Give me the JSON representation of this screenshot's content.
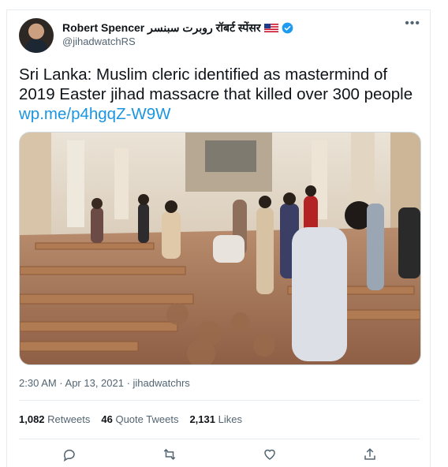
{
  "author": {
    "display_name": "Robert Spencer روبرت سبنسر रॉबर्ट स्पेंसर",
    "handle": "@jihadwatchRS"
  },
  "tweet": {
    "text": "Sri Lanka: Muslim cleric identified as mastermind of 2019 Easter jihad massacre that killed over 300 people",
    "link": "wp.me/p4hgqZ-W9W"
  },
  "meta": {
    "timestamp": "2:30 AM · Apr 13, 2021 · jihadwatchrs"
  },
  "stats": {
    "retweets_count": "1,082",
    "retweets_label": "Retweets",
    "quotes_count": "46",
    "quotes_label": "Quote Tweets",
    "likes_count": "2,131",
    "likes_label": "Likes"
  },
  "icons": {
    "more": "more-options-icon",
    "verified": "verified-badge-icon",
    "flag": "us-flag-icon",
    "reply": "reply-icon",
    "retweet": "retweet-icon",
    "like": "heart-icon",
    "share": "share-icon"
  },
  "colors": {
    "accent": "#1b95e0",
    "verified": "#1d9bf0",
    "secondary_text": "#536471"
  }
}
